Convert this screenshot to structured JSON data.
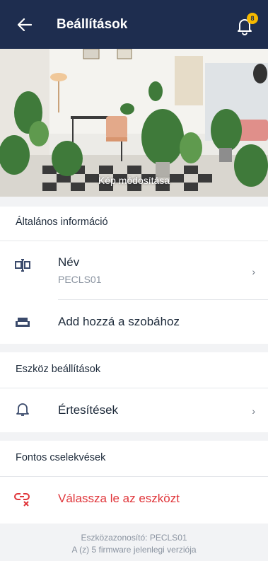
{
  "header": {
    "title": "Beállítások",
    "notification_count": "8"
  },
  "hero": {
    "caption": "Kép módosítása"
  },
  "general": {
    "heading": "Általános információ",
    "name_label": "Név",
    "name_value": "PECLS01",
    "chevron": "›",
    "room_label": "Add hozzá a szobához"
  },
  "device_settings": {
    "heading": "Eszköz beállítások",
    "notifications_label": "Értesítések",
    "chevron": "›"
  },
  "important": {
    "heading": "Fontos cselekvések",
    "unlink_label": "Válassza le az eszközt"
  },
  "footer": {
    "device_id": "Eszközazonosító: PECLS01",
    "firmware": "A (z) 5 firmware jelenlegi verziója"
  },
  "colors": {
    "header_bg": "#1e2d4f",
    "danger": "#e0353a",
    "badge": "#f5b800"
  }
}
